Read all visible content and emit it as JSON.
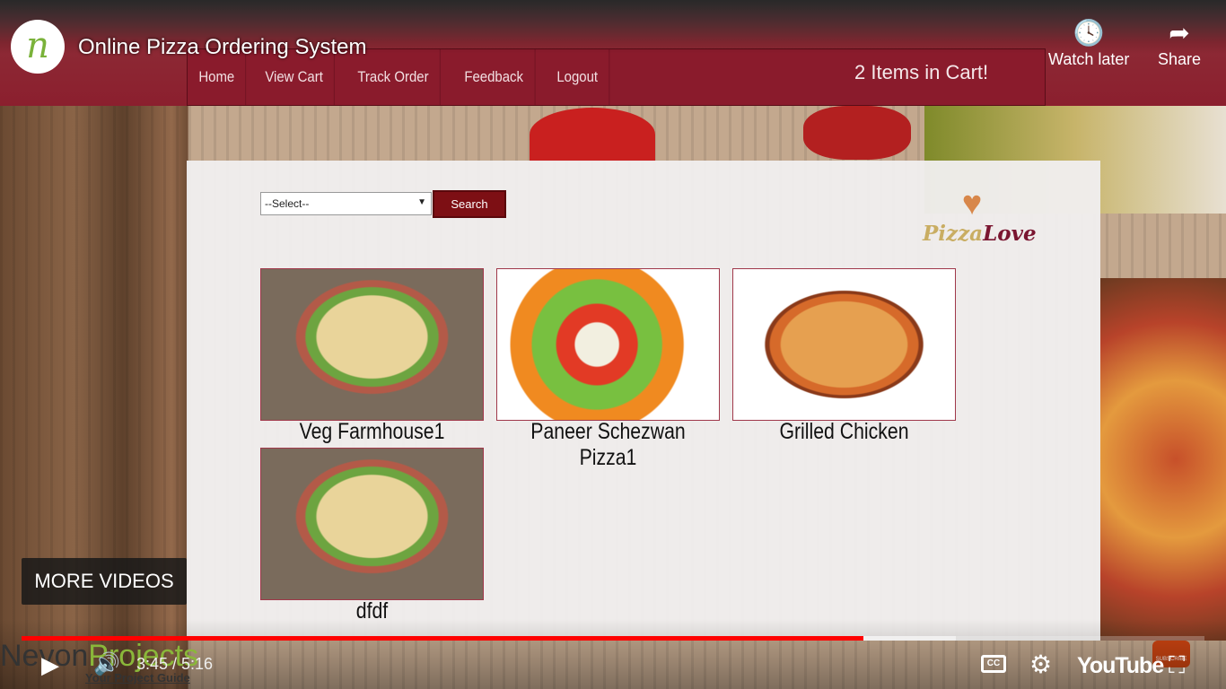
{
  "video": {
    "title": "Online Pizza Ordering System",
    "channel_initial": "n",
    "watch_later": "Watch later",
    "share": "Share",
    "more_videos": "MORE VIDEOS",
    "time": "3:45 / 5:16",
    "progress_fraction": 0.712,
    "buffered_fraction": 0.79,
    "brand": "YouTube",
    "progress_color": "#ff0000"
  },
  "watermark": {
    "part1": "Nevon",
    "part2": "Projects",
    "tagline": "Your Project Guide"
  },
  "site": {
    "nav": [
      "Home",
      "View Cart",
      "Track Order",
      "Feedback",
      "Logout"
    ],
    "cart_message": "2 Items in Cart!",
    "select_value": "--Select--",
    "search_label": "Search",
    "logo": {
      "part1": "Pizza",
      "part2": "Love"
    },
    "items": [
      {
        "name": "Veg Farmhouse1"
      },
      {
        "name": "Paneer Schezwan Pizza1"
      },
      {
        "name": "Grilled Chicken"
      },
      {
        "name": "dfdf"
      }
    ],
    "accent": "#8a1b2c"
  }
}
